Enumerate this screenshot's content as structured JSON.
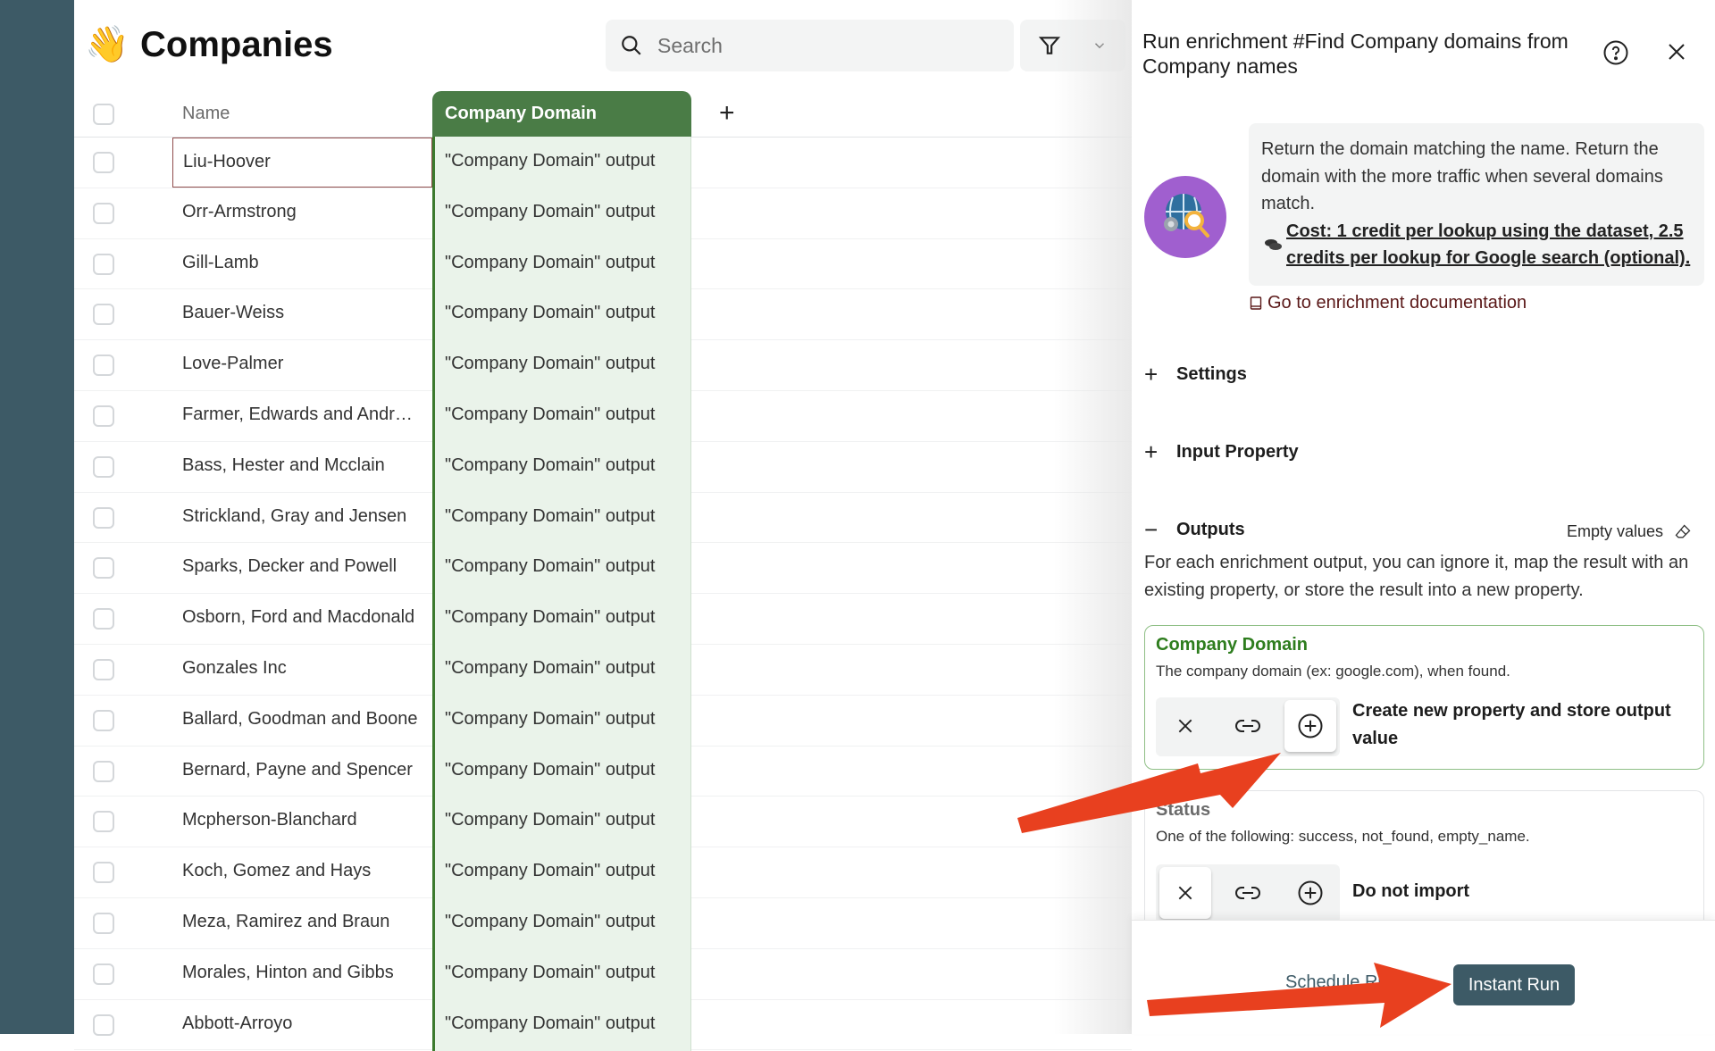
{
  "page": {
    "emoji": "👋",
    "title": "Companies"
  },
  "search": {
    "placeholder": "Search",
    "value": ""
  },
  "filter": {
    "icon": "filter-icon",
    "dropdown_icon": "chevron-down-icon"
  },
  "table": {
    "columns": {
      "name": "Name",
      "domain": "Company Domain",
      "add": "+"
    },
    "rows": [
      {
        "name": "Liu-Hoover",
        "domain": "\"Company Domain\" output"
      },
      {
        "name": "Orr-Armstrong",
        "domain": "\"Company Domain\" output"
      },
      {
        "name": "Gill-Lamb",
        "domain": "\"Company Domain\" output"
      },
      {
        "name": "Bauer-Weiss",
        "domain": "\"Company Domain\" output"
      },
      {
        "name": "Love-Palmer",
        "domain": "\"Company Domain\" output"
      },
      {
        "name": "Farmer, Edwards and Andrade",
        "domain": "\"Company Domain\" output"
      },
      {
        "name": "Bass, Hester and Mcclain",
        "domain": "\"Company Domain\" output"
      },
      {
        "name": "Strickland, Gray and Jensen",
        "domain": "\"Company Domain\" output"
      },
      {
        "name": "Sparks, Decker and Powell",
        "domain": "\"Company Domain\" output"
      },
      {
        "name": "Osborn, Ford and Macdonald",
        "domain": "\"Company Domain\" output"
      },
      {
        "name": "Gonzales Inc",
        "domain": "\"Company Domain\" output"
      },
      {
        "name": "Ballard, Goodman and Boone",
        "domain": "\"Company Domain\" output"
      },
      {
        "name": "Bernard, Payne and Spencer",
        "domain": "\"Company Domain\" output"
      },
      {
        "name": "Mcpherson-Blanchard",
        "domain": "\"Company Domain\" output"
      },
      {
        "name": "Koch, Gomez and Hays",
        "domain": "\"Company Domain\" output"
      },
      {
        "name": "Meza, Ramirez and Braun",
        "domain": "\"Company Domain\" output"
      },
      {
        "name": "Morales, Hinton and Gibbs",
        "domain": "\"Company Domain\" output"
      },
      {
        "name": "Abbott-Arroyo",
        "domain": "\"Company Domain\" output"
      }
    ]
  },
  "panel": {
    "title": "Run enrichment #Find Company domains from Company names",
    "description": "Return the domain matching the name. Return the domain with the more traffic when several domains match.",
    "cost": "Cost: 1 credit per lookup using the dataset, 2.5 credits per lookup for Google search (optional).",
    "doc_link": "Go to enrichment documentation",
    "sections": {
      "settings": "Settings",
      "input_property": "Input Property",
      "outputs": "Outputs"
    },
    "empty_values": "Empty values",
    "outputs_description": "For each enrichment output, you can ignore it, map the result with an existing property, or store the result into a new property.",
    "outputs": [
      {
        "name": "Company Domain",
        "description": "The company domain (ex: google.com), when found.",
        "selected_option": "create",
        "label": "Create new property and store output value"
      },
      {
        "name": "Status",
        "description": "One of the following: success, not_found, empty_name.",
        "selected_option": "ignore",
        "label": "Do not import"
      }
    ],
    "footer": {
      "schedule_label": "Schedule Run",
      "instant_label": "Instant Run"
    }
  },
  "colors": {
    "sidebar": "#3d5a66",
    "domain_header": "#4a7c46",
    "domain_cell": "#eaf3ea",
    "accent_green": "#2e7d1e",
    "primary_button": "#3d5a66",
    "annotation_arrow": "#e8401f",
    "avatar": "#a05fcf"
  }
}
